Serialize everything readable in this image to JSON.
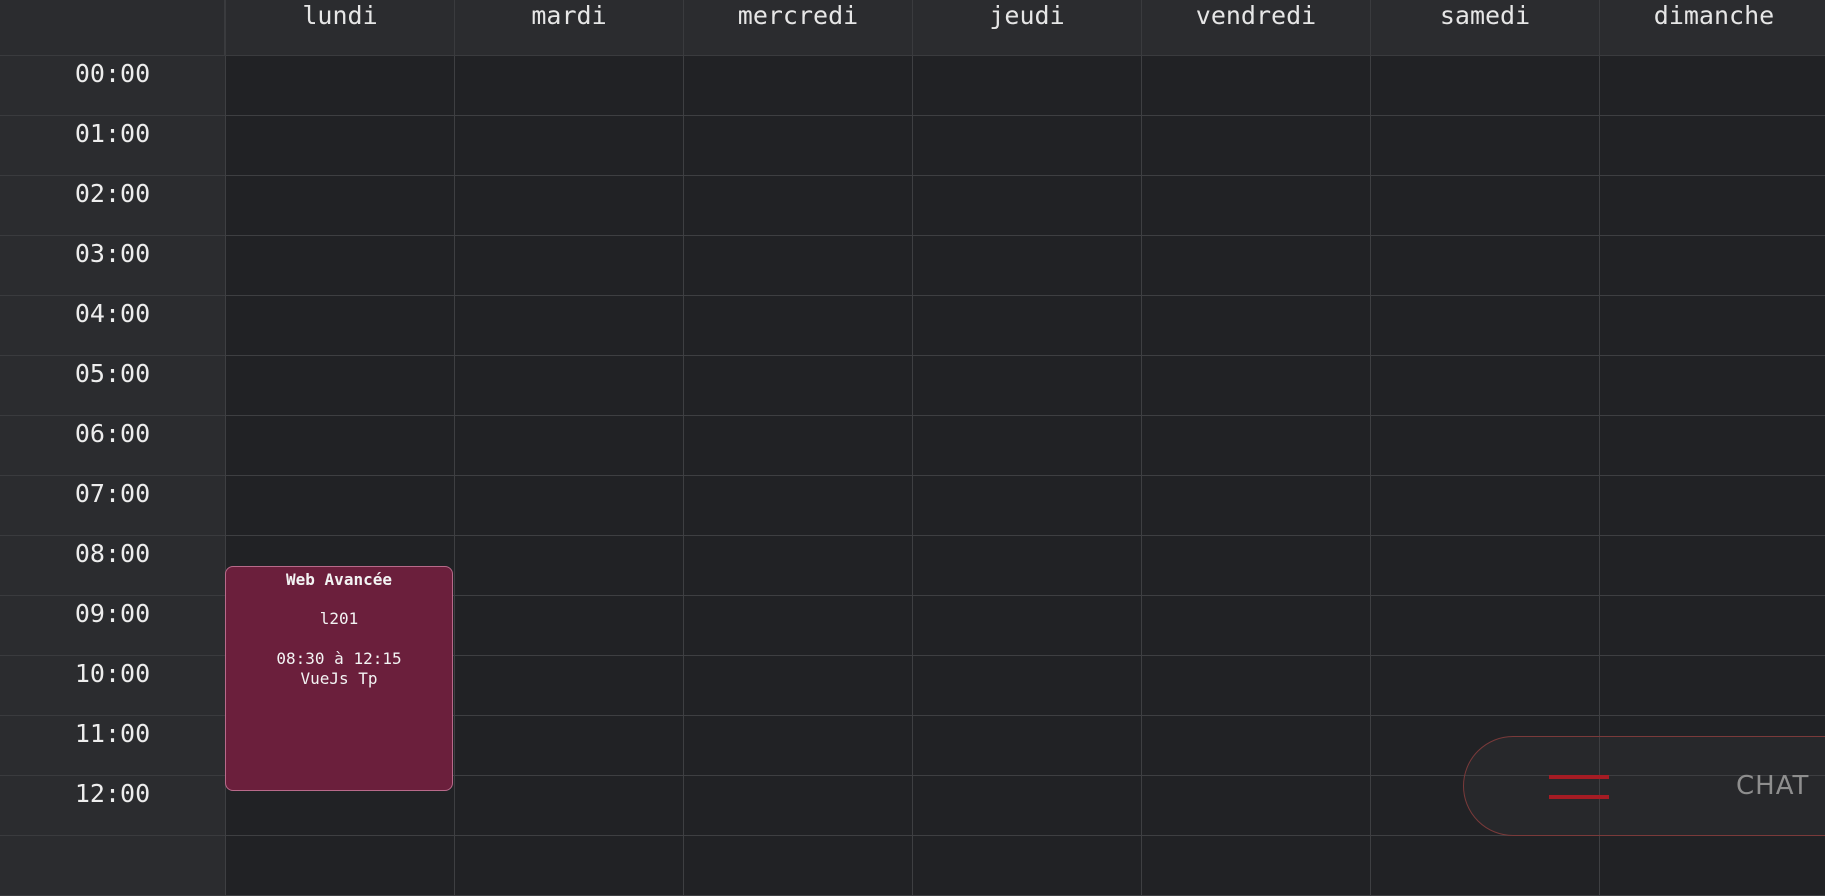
{
  "days": [
    "lundi",
    "mardi",
    "mercredi",
    "jeudi",
    "vendredi",
    "samedi",
    "dimanche"
  ],
  "hours": [
    "00:00",
    "01:00",
    "02:00",
    "03:00",
    "04:00",
    "05:00",
    "06:00",
    "07:00",
    "08:00",
    "09:00",
    "10:00",
    "11:00",
    "12:00"
  ],
  "event": {
    "title": "Web Avancée",
    "room": "l201",
    "time_range": "08:30 à 12:15",
    "description": "VueJs Tp",
    "color": "#6b1f3c",
    "border_color": "#b86a8a"
  },
  "chat": {
    "label": "CHAT",
    "icon": "menu-icon",
    "accent": "#a51c24"
  },
  "colors": {
    "background": "#212225",
    "header_background": "#2b2c2f",
    "grid_line": "#3e3f42"
  }
}
